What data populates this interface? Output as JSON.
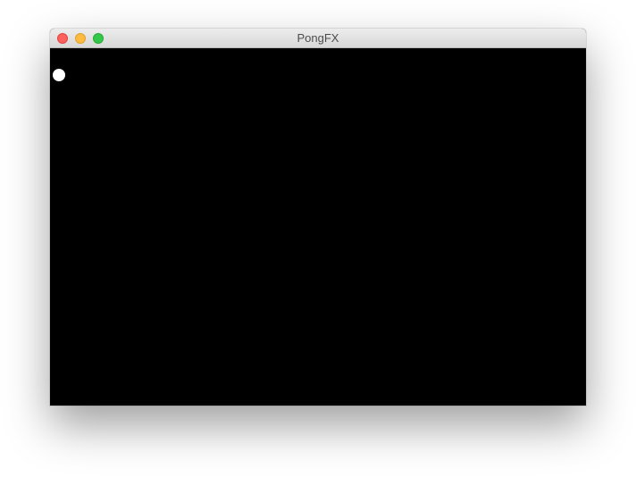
{
  "window": {
    "title": "PongFX",
    "controls": {
      "close": "close-icon",
      "minimize": "minimize-icon",
      "zoom": "zoom-icon"
    },
    "colors": {
      "close": "#fc605c",
      "minimize": "#fdbc40",
      "zoom": "#34c84a"
    }
  },
  "game": {
    "background_color": "#000000",
    "ball_color": "#ffffff"
  }
}
